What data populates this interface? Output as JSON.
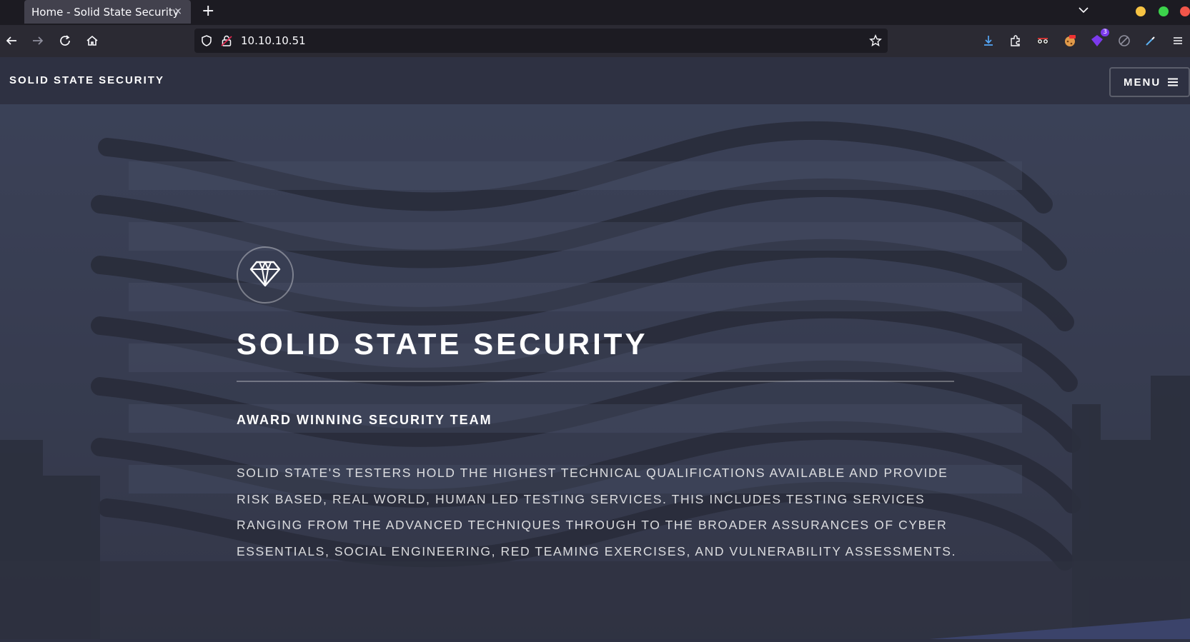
{
  "browser": {
    "tab_title": "Home - Solid State Security",
    "tab_close": "×",
    "new_tab": "+",
    "url": "10.10.10.51",
    "extension_badge": "3"
  },
  "header": {
    "site_title": "SOLID STATE SECURITY",
    "menu_label": "MENU"
  },
  "hero": {
    "icon": "diamond-icon",
    "title": "SOLID STATE SECURITY",
    "subtitle": "AWARD WINNING SECURITY TEAM",
    "body": "SOLID STATE'S TESTERS HOLD THE HIGHEST TECHNICAL QUALIFICATIONS AVAILABLE AND PROVIDE RISK BASED, REAL WORLD, HUMAN LED TESTING SERVICES. THIS INCLUDES TESTING SERVICES RANGING FROM THE ADVANCED TECHNIQUES THROUGH TO THE BROADER ASSURANCES OF CYBER ESSENTIALS, SOCIAL ENGINEERING, RED TEAMING EXERCISES, AND VULNERABILITY ASSESSMENTS."
  },
  "colors": {
    "header_bg": "#2e3142",
    "accent": "#4c5a9c"
  }
}
